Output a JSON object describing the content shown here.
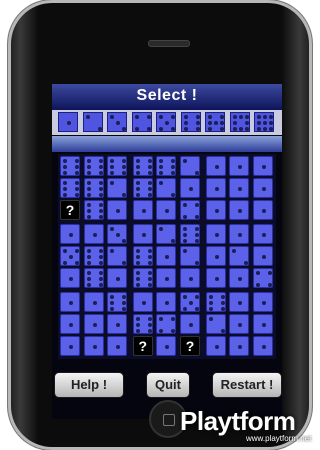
{
  "header": {
    "title": "Select !"
  },
  "selector": {
    "values": [
      1,
      2,
      3,
      4,
      5,
      6,
      7,
      8,
      9
    ]
  },
  "grid": {
    "board": [
      [
        6,
        6,
        6,
        6,
        6,
        2,
        1,
        1,
        1
      ],
      [
        6,
        6,
        2,
        6,
        2,
        1,
        1,
        1,
        1
      ],
      [
        0,
        6,
        1,
        1,
        1,
        4,
        1,
        1,
        1
      ],
      [
        1,
        1,
        3,
        1,
        2,
        6,
        1,
        1,
        1
      ],
      [
        5,
        6,
        2,
        6,
        1,
        2,
        1,
        2,
        1
      ],
      [
        1,
        6,
        1,
        6,
        1,
        1,
        1,
        1,
        4
      ],
      [
        1,
        1,
        6,
        1,
        1,
        5,
        6,
        1,
        1
      ],
      [
        1,
        1,
        1,
        6,
        4,
        1,
        2,
        1,
        1
      ],
      [
        1,
        1,
        1,
        0,
        1,
        0,
        1,
        1,
        1
      ]
    ],
    "unknown_label": "?"
  },
  "buttons": {
    "help": "Help !",
    "quit": "Quit",
    "restart": "Restart !"
  },
  "watermark": {
    "brand": "Playtform",
    "url": "www.playtform.net"
  },
  "colors": {
    "tile": "#5b61e8",
    "pip": "#1a1f55",
    "header_top": "#3d4aa0",
    "header_bottom": "#0d145a"
  }
}
